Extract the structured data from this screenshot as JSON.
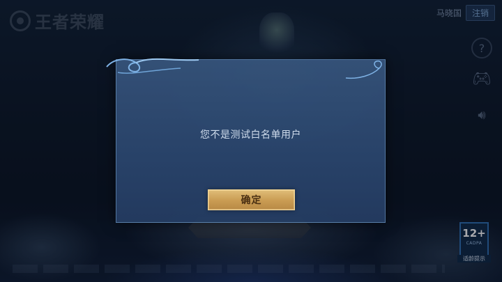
{
  "game": {
    "logo_text": "王者荣耀"
  },
  "account": {
    "username": "马晓国",
    "logout_label": "注销"
  },
  "sidebar": {
    "icons": [
      "help-icon",
      "gamepad-icon",
      "sound-icon"
    ]
  },
  "dialog": {
    "message": "您不是测试白名单用户",
    "confirm_label": "确定"
  },
  "age_rating": {
    "rating": "12+",
    "org": "CADPA",
    "caption": "适龄提示"
  },
  "colors": {
    "dialog_bg": "#36567f",
    "confirm_gold": "#d2a75f",
    "logout_blue": "#7ea6d3"
  }
}
